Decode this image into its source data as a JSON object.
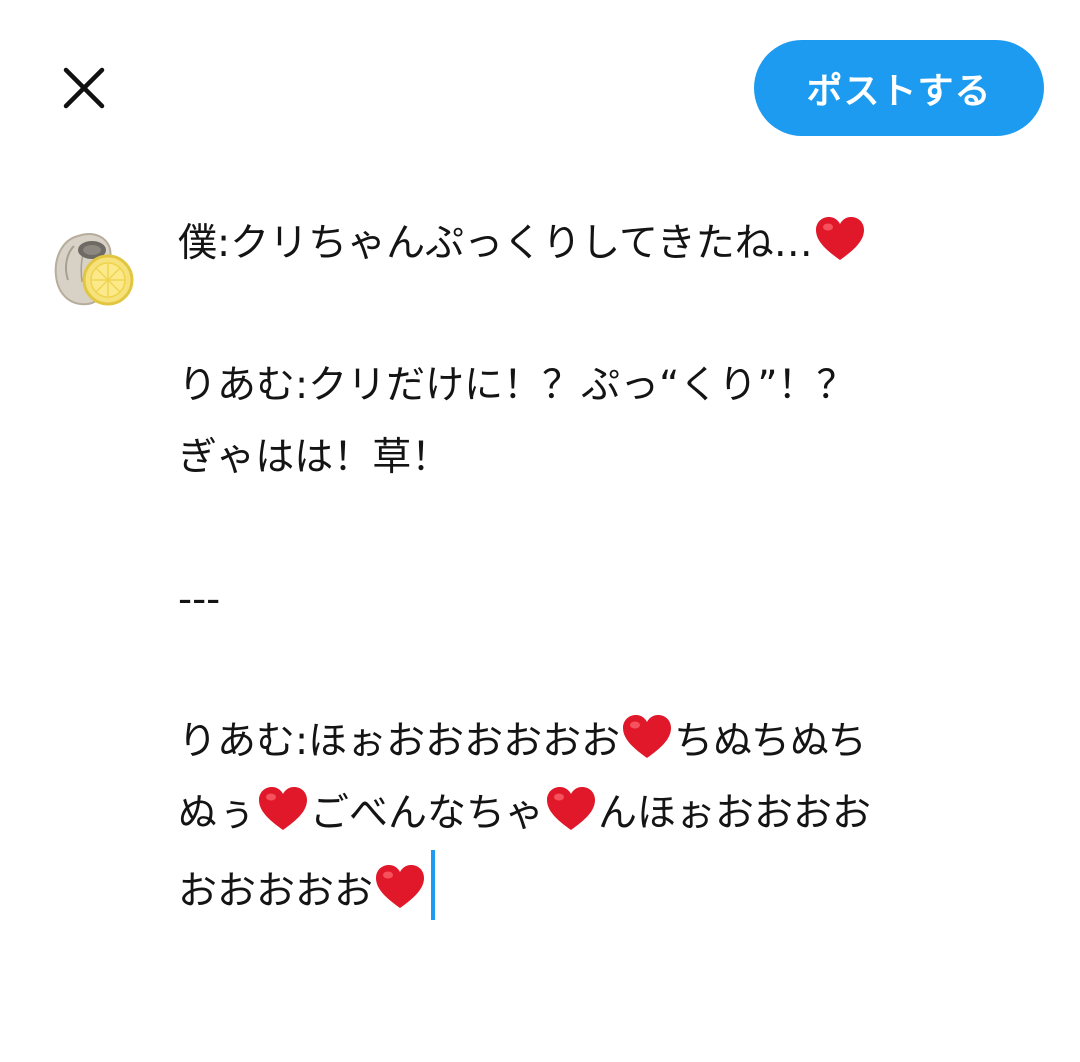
{
  "header": {
    "close_label": "×",
    "post_label": "ポストする"
  },
  "colors": {
    "accent": "#1d9bf0",
    "heart": "#e0182a"
  },
  "icons": {
    "close": "close-icon",
    "heart": "red-heart-icon",
    "avatar": "oyster-lemon-avatar"
  },
  "draft": {
    "line1": "僕:クリちゃんぷっくりしてきたね…",
    "line2": "りあむ:クリだけに！？ぷっ“くり”！？",
    "line3": "ぎゃはは！草！",
    "line4": "---",
    "line5a": "りあむ:ほぉおおおおおお",
    "line5b": "ちぬちぬち",
    "line6a": "ぬぅ",
    "line6b": "ごべんなちゃ",
    "line6c": "んほぉおおおお",
    "line7a": "おおおおお"
  }
}
